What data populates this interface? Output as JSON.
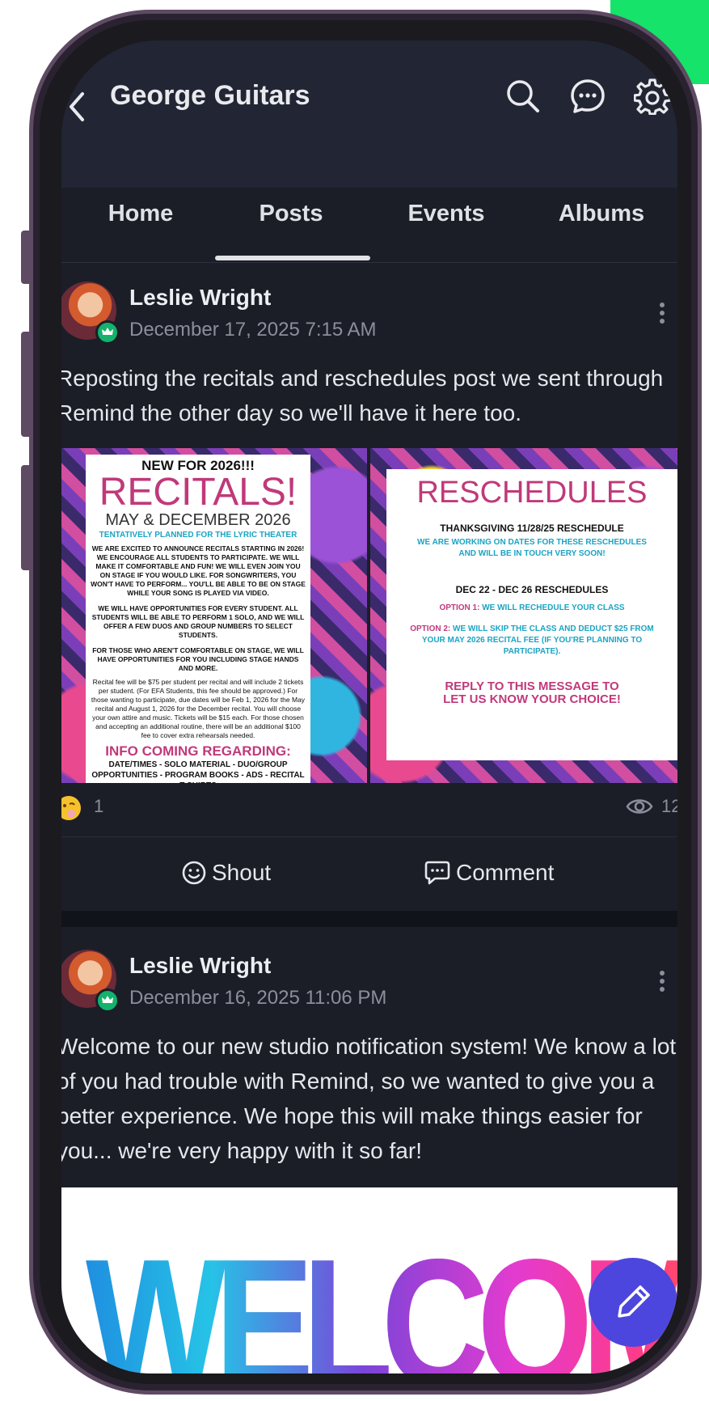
{
  "app": {
    "group_name": "George Guitars"
  },
  "tabs": [
    {
      "label": "Home"
    },
    {
      "label": "Posts"
    },
    {
      "label": "Events"
    },
    {
      "label": "Albums"
    }
  ],
  "active_tab": "Posts",
  "posts": [
    {
      "author": "Leslie Wright",
      "date": "December 17, 2025 7:15 AM",
      "text": "Reposting the recitals and reschedules post we sent through Remind the other day so we'll have it here too.",
      "reactions_count": "1",
      "views_count": "12",
      "recitals_poster": {
        "kicker": "NEW FOR 2026!!!",
        "heading": "RECITALS!",
        "dates": "MAY & DECEMBER 2026",
        "subhead": "TENTATIVELY PLANNED FOR THE LYRIC THEATER",
        "para1": "WE ARE EXCITED TO ANNOUNCE RECITALS STARTING IN 2026! WE ENCOURAGE ALL STUDENTS TO PARTICIPATE. WE WILL MAKE IT COMFORTABLE AND FUN! WE WILL EVEN JOIN YOU ON STAGE IF YOU WOULD LIKE. FOR SONGWRITERS, YOU WON'T HAVE TO PERFORM... YOU'LL BE ABLE TO BE ON STAGE WHILE YOUR SONG IS PLAYED VIA VIDEO.",
        "para2": "WE WILL HAVE OPPORTUNITIES FOR EVERY STUDENT. ALL STUDENTS WILL BE ABLE TO PERFORM 1 SOLO, AND WE WILL OFFER A FEW DUOS AND GROUP NUMBERS TO SELECT STUDENTS.",
        "para3": "FOR THOSE WHO AREN'T COMFORTABLE ON STAGE, WE WILL HAVE OPPORTUNITIES FOR YOU INCLUDING STAGE HANDS AND MORE.",
        "para4": "Recital fee will be $75 per student per recital and will include 2 tickets per student. (For EFA Students, this fee should be approved.) For those wanting to participate, due dates will be Feb 1, 2026 for the May recital and August 1, 2026 for the December recital. You will choose your own attire and music. Tickets will be $15 each. For those chosen and accepting an additional routine, there will be an additional $100 fee to cover extra rehearsals needed.",
        "info_heading": "INFO COMING REGARDING:",
        "info_list": "DATE/TIMES - SOLO MATERIAL - DUO/GROUP OPPORTUNITIES - PROGRAM BOOKS - ADS - RECITAL T-SHIRTS"
      },
      "reschedules_poster": {
        "heading": "RESCHEDULES",
        "thanksgiving_title": "THANKSGIVING 11/28/25 RESCHEDULE",
        "thanksgiving_body": "WE ARE WORKING ON DATES FOR THESE RESCHEDULES AND WILL BE IN TOUCH VERY SOON!",
        "dec_title": "DEC 22 - DEC 26 RESCHEDULES",
        "option1_label": "OPTION 1:",
        "option1_text": "WE WILL RECHEDULE YOUR CLASS",
        "option2_label": "OPTION 2:",
        "option2_text": "WE WILL SKIP THE CLASS AND DEDUCT $25 FROM YOUR MAY 2026 RECITAL FEE (IF YOU'RE PLANNING TO PARTICIPATE).",
        "reply": "REPLY TO THIS MESSAGE TO LET US KNOW YOUR CHOICE!"
      }
    },
    {
      "author": "Leslie Wright",
      "date": "December 16, 2025 11:06 PM",
      "text": "Welcome to our new studio notification system! We know a lot of you had trouble with Remind, so we wanted to give you a better experience.  We hope this will make things easier for you... we're very happy with it so far!",
      "image_text": "WELCOME"
    }
  ],
  "actions": {
    "shout": "Shout",
    "comment": "Comment"
  },
  "colors": {
    "accent": "#4c46de",
    "badge": "#14b26c",
    "background": "#1b1e27",
    "corner": "#16e36a"
  }
}
